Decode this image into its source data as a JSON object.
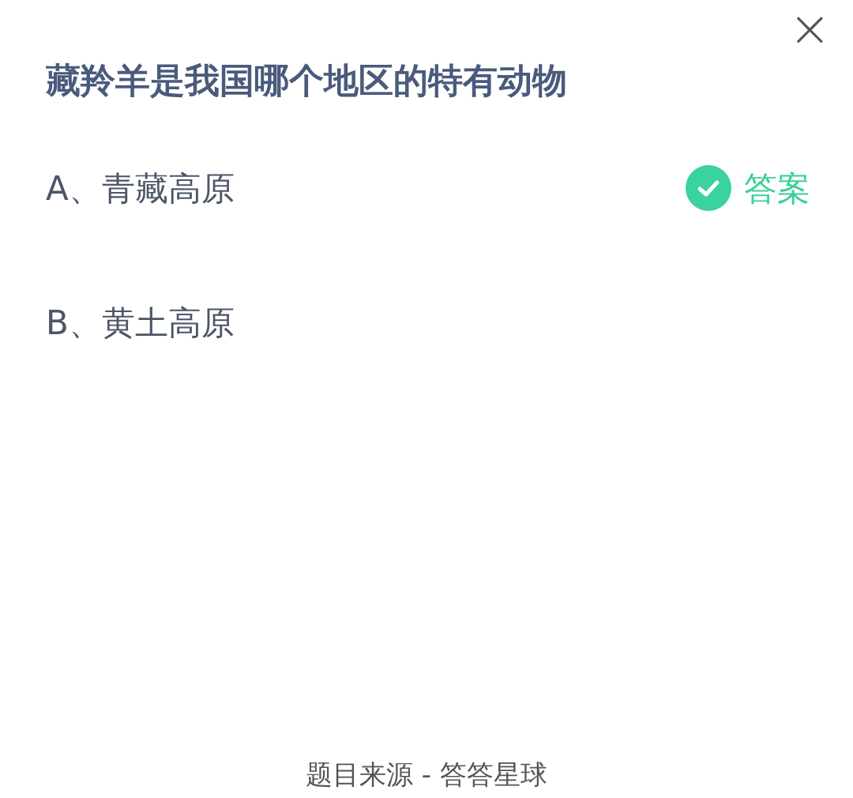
{
  "close_button": {
    "symbol": "×"
  },
  "question": "藏羚羊是我国哪个地区的特有动物",
  "answer_label": "答案",
  "options": [
    {
      "label": "A、青藏高原",
      "correct": true
    },
    {
      "label": "B、黄土高原",
      "correct": false
    }
  ],
  "source": "题目来源 - 答答星球"
}
